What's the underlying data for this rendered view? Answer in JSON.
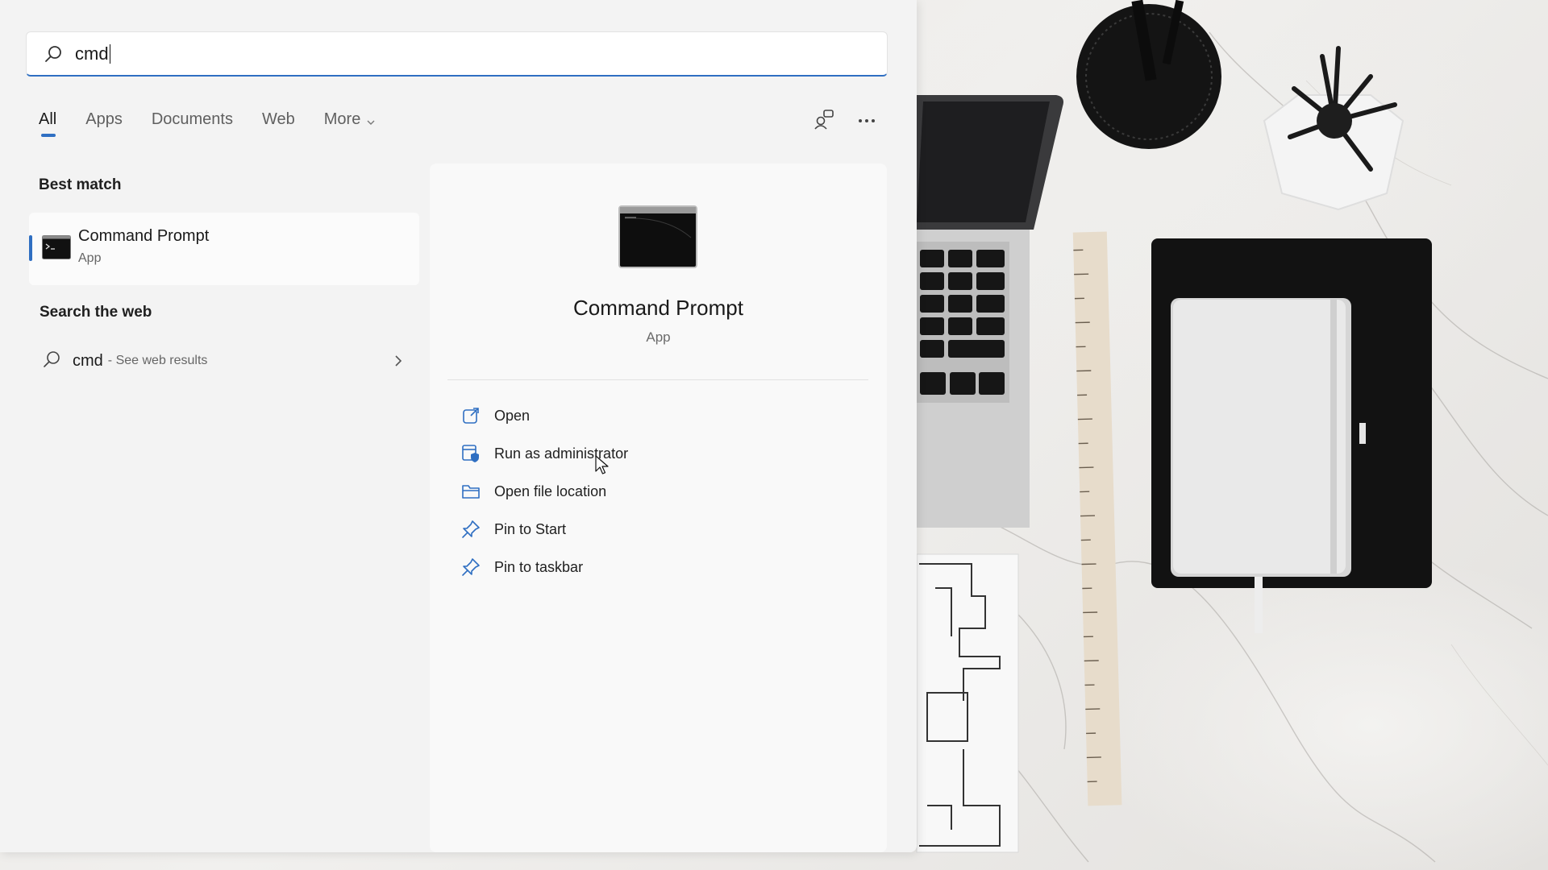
{
  "search": {
    "value": "cmd"
  },
  "tabs": [
    {
      "label": "All",
      "active": true
    },
    {
      "label": "Apps",
      "active": false
    },
    {
      "label": "Documents",
      "active": false
    },
    {
      "label": "Web",
      "active": false
    },
    {
      "label": "More",
      "active": false
    }
  ],
  "toolbar": {
    "share_icon": "account-share-icon",
    "more_icon": "more-options-icon"
  },
  "best_match": {
    "heading": "Best match",
    "name": "Command Prompt",
    "kind": "App"
  },
  "search_web": {
    "heading": "Search the web",
    "term": "cmd",
    "hint": "- See web results"
  },
  "preview": {
    "title": "Command Prompt",
    "subtitle": "App",
    "actions": [
      {
        "label": "Open",
        "icon": "open-external-icon"
      },
      {
        "label": "Run as administrator",
        "icon": "shield-admin-icon"
      },
      {
        "label": "Open file location",
        "icon": "folder-icon"
      },
      {
        "label": "Pin to Start",
        "icon": "pin-icon"
      },
      {
        "label": "Pin to taskbar",
        "icon": "pin-icon"
      }
    ]
  },
  "colors": {
    "accent": "#2f6fc2",
    "panel": "#f3f3f3",
    "preview": "#f9f9f9"
  }
}
